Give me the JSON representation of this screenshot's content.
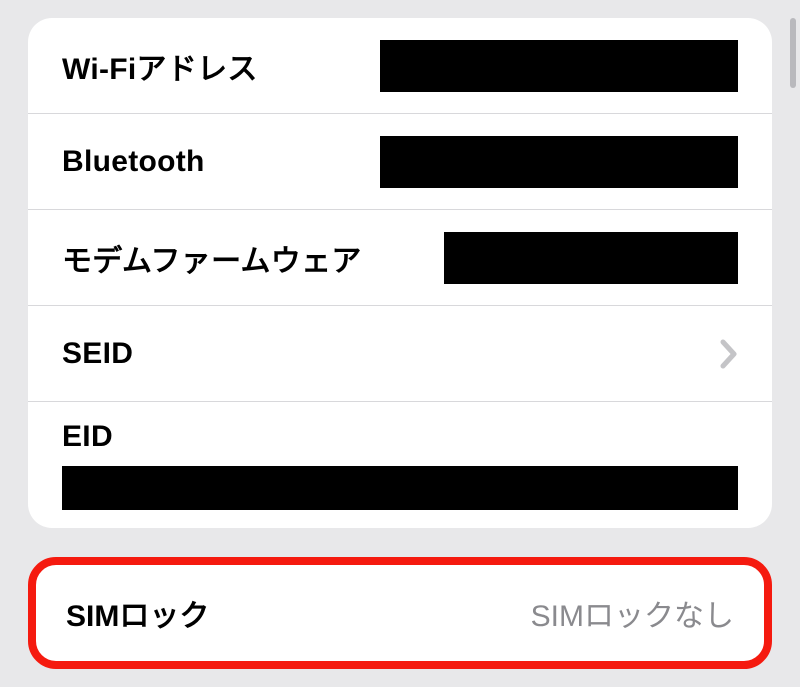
{
  "rows": {
    "wifi": {
      "label": "Wi-Fiアドレス"
    },
    "bluetooth": {
      "label": "Bluetooth"
    },
    "modem": {
      "label": "モデムファームウェア"
    },
    "seid": {
      "label": "SEID"
    },
    "eid": {
      "label": "EID"
    },
    "simlock": {
      "label": "SIMロック",
      "value": "SIMロックなし"
    }
  }
}
